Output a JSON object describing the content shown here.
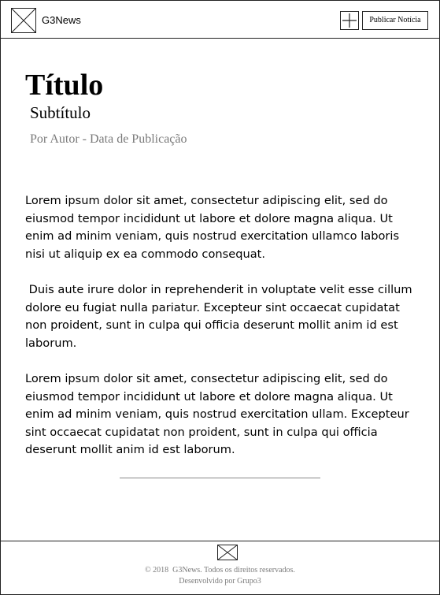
{
  "header": {
    "brand": "G3News",
    "publish_label": "Publicar Notícia",
    "logo_icon": "image-placeholder-icon",
    "add_icon": "plus-icon"
  },
  "article": {
    "title": "Título",
    "subtitle": "Subtítulo",
    "author": "Por Autor -",
    "date": "Data de Publicação",
    "paragraphs": [
      "Lorem ipsum dolor sit amet, consectetur adipiscing elit, sed do eiusmod tempor incididunt ut labore et dolore magna aliqua. Ut enim ad minim veniam, quis nostrud exercitation ullamco laboris nisi ut aliquip ex ea commodo consequat.",
      " Duis aute irure dolor in reprehenderit in voluptate velit esse cillum dolore eu fugiat nulla pariatur. Excepteur sint occaecat cupidatat non proident, sunt in culpa qui officia deserunt mollit anim id est laborum.",
      "Lorem ipsum dolor sit amet, consectetur adipiscing elit, sed do eiusmod tempor incididunt ut labore et dolore magna aliqua. Ut enim ad minim veniam, quis nostrud exercitation ullam. Excepteur sint occaecat cupidatat non proident, sunt in culpa qui officia deserunt mollit anim id est laborum."
    ]
  },
  "footer": {
    "copyright": "© 2018  G3News. Todos os direitos reservados.",
    "credit": "Desenvolvido por Grupo3",
    "mail_icon": "mail-icon"
  }
}
